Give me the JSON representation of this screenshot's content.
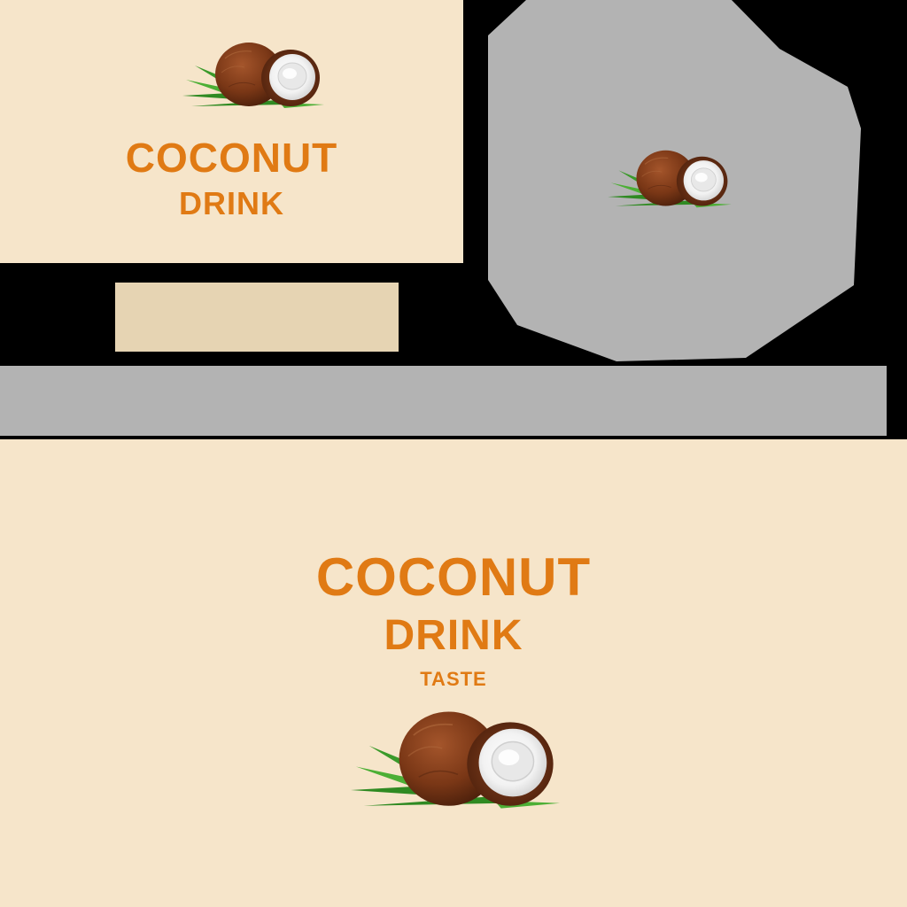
{
  "label_small": {
    "title": "COCONUT",
    "subtitle": "DRINK",
    "icon": "coconut-icon"
  },
  "label_large": {
    "title": "COCONUT",
    "subtitle": "DRINK",
    "tagline": "TASTE",
    "icon": "coconut-icon"
  },
  "colors": {
    "background": "#000000",
    "cream": "#f6e5ca",
    "swatch": "#e6d4b3",
    "gray": "#b3b3b3",
    "accent_text": "#e07a14",
    "coconut_shell": "#7a3716",
    "coconut_flesh": "#ffffff",
    "leaf": "#3a9a2a"
  }
}
